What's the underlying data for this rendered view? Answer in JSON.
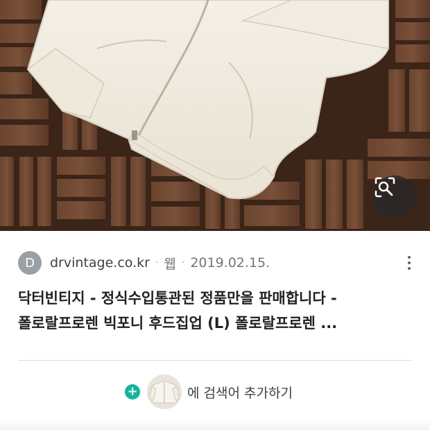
{
  "image": {
    "subject": "white zip-up hoodie lying on wooden deck tiles",
    "lens_button_icon": "image-search-icon"
  },
  "result": {
    "favicon_letter": "D",
    "domain": "drvintage.co.kr",
    "separator": "·",
    "type": "웹",
    "date": "2019.02.15.",
    "more_icon": "more-vert-icon",
    "title_line1": "닥터빈티지 - 정식수입통관된 정품만을 판매합니다 -",
    "title_line2": "폴로랄프로렌 빅포니 후드집업 (L) 폴로랄프로렌 ..."
  },
  "add_search": {
    "plus_icon": "plus-icon",
    "label": "에 검색어 추가하기"
  },
  "colors": {
    "accent": "#13b39f",
    "favicon_bg": "#9aa0a6",
    "text_primary": "#202124",
    "text_secondary": "#70757a"
  }
}
